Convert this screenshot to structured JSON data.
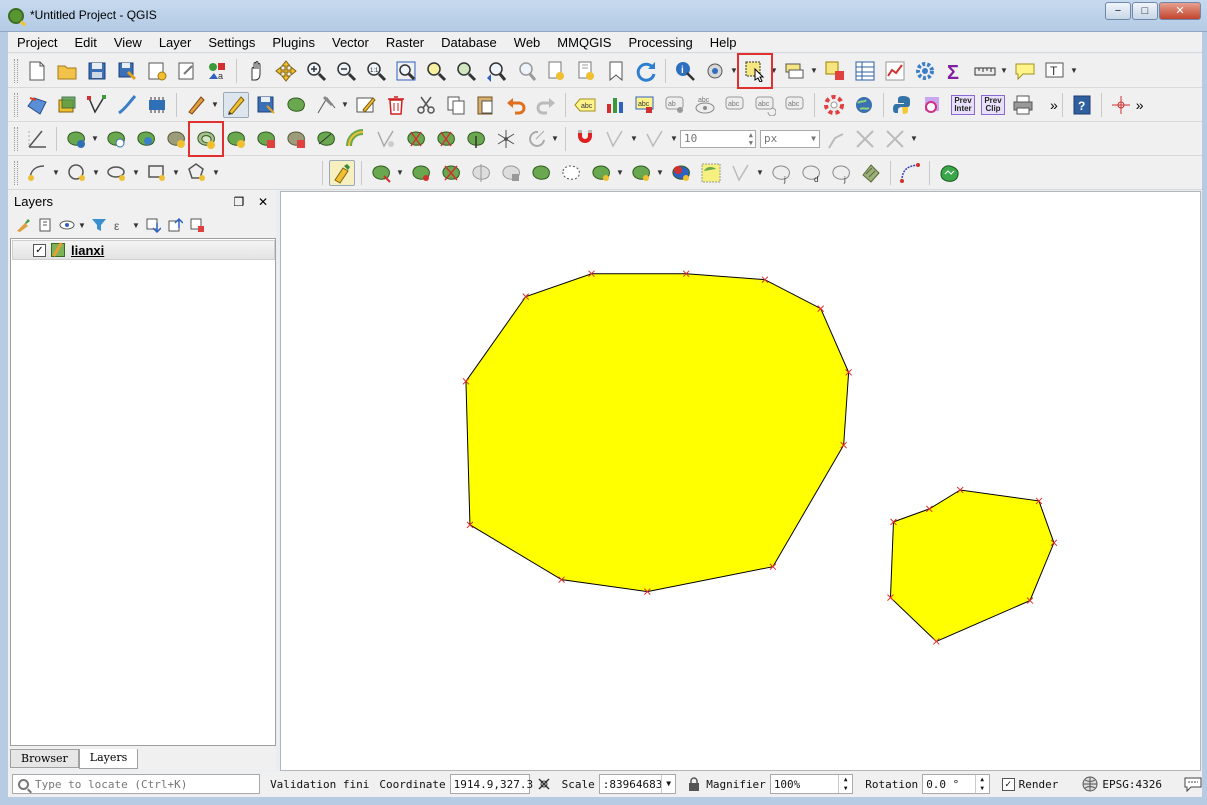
{
  "window": {
    "title": "*Untitled Project - QGIS",
    "minimize": "−",
    "maximize": "□",
    "close": "✕"
  },
  "menu": [
    "Project",
    "Edit",
    "View",
    "Layer",
    "Settings",
    "Plugins",
    "Vector",
    "Raster",
    "Database",
    "Web",
    "MMQGIS",
    "Processing",
    "Help"
  ],
  "toolbar": {
    "snap_tolerance": "10",
    "snap_units": "px",
    "prev_inter": "Prev Inter",
    "prev_clip": "Prev Clip",
    "more": "»"
  },
  "layers_panel": {
    "title": "Layers",
    "float_glyph": "❐",
    "close_glyph": "✕",
    "layers": [
      {
        "name": "lianxi",
        "visible": true,
        "check": "✓"
      }
    ],
    "tabs": [
      "Browser",
      "Layers"
    ]
  },
  "map": {
    "background": "#ffffff",
    "fill": "#ffff00",
    "vertex_color": "#e03030"
  },
  "status": {
    "locate_placeholder": "Type to locate (Ctrl+K)",
    "message": "Validation fini",
    "coordinate_label": "Coordinate",
    "coordinate": "1914.9,327.3",
    "scale_label": "Scale",
    "scale": ":83964683",
    "magnifier_label": "Magnifier",
    "magnifier": "100%",
    "rotation_label": "Rotation",
    "rotation": "0.0 °",
    "render_label": "Render",
    "render_check": "✓",
    "crs": "EPSG:4326"
  }
}
